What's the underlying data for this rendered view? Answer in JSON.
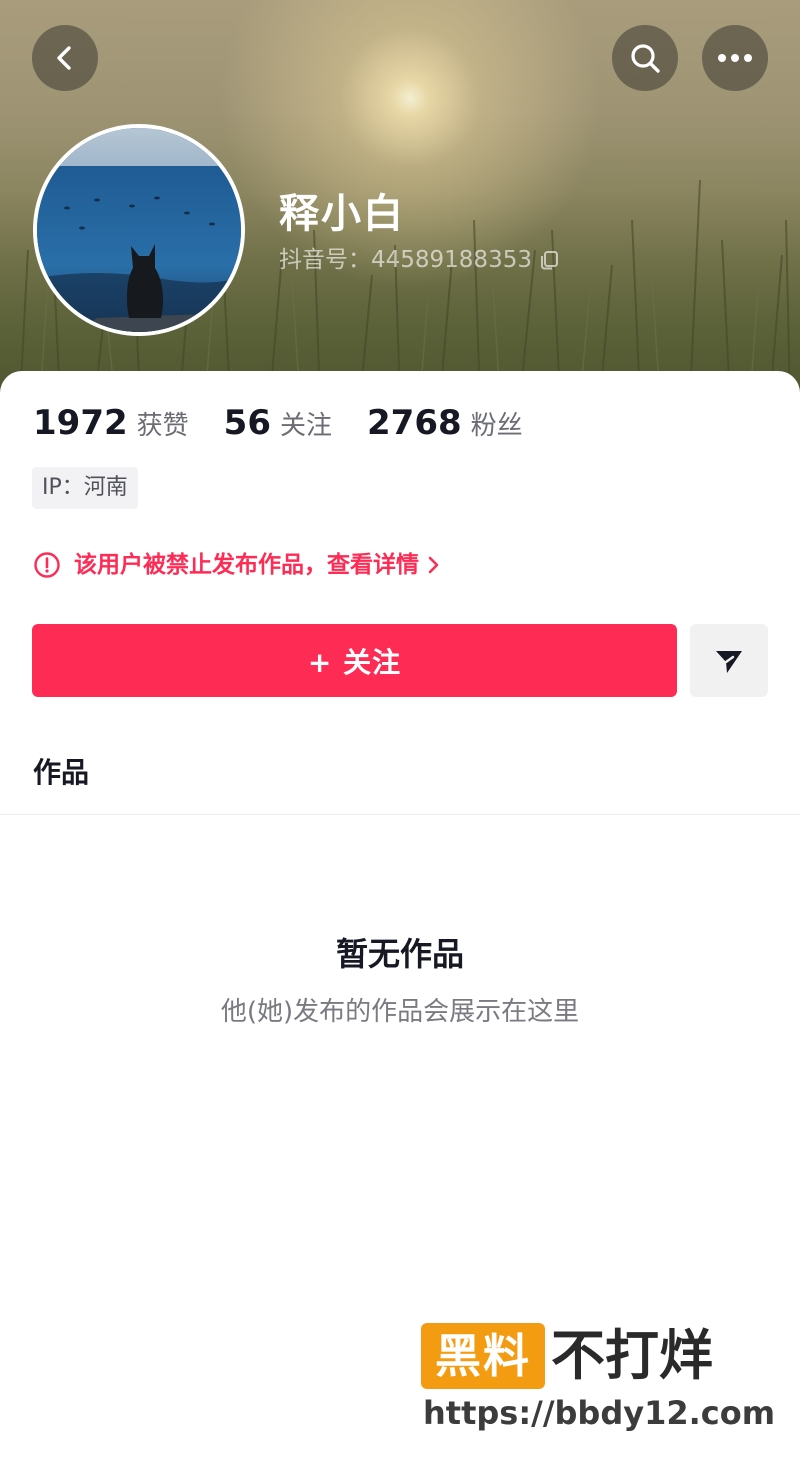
{
  "header": {
    "back_icon": "chevron-left-icon",
    "search_icon": "search-icon",
    "more_icon": "more-horizontal-icon"
  },
  "profile": {
    "nickname": "释小白",
    "douyin_id_text": "抖音号：44589188353",
    "copy_icon": "copy-icon"
  },
  "stats": [
    {
      "value": "1972",
      "label": "获赞"
    },
    {
      "value": "56",
      "label": "关注"
    },
    {
      "value": "2768",
      "label": "粉丝"
    }
  ],
  "ip_tag": "IP：河南",
  "notice": {
    "icon": "alert-circle-icon",
    "text": "该用户被禁止发布作品，查看详情",
    "color": "#fe2c55"
  },
  "actions": {
    "follow_label": "+ 关注",
    "message_icon": "send-icon",
    "accent": "#fe2c55"
  },
  "tabs": {
    "works_label": "作品"
  },
  "empty_state": {
    "title": "暂无作品",
    "subtitle": "他(她)发布的作品会展示在这里"
  },
  "watermark": {
    "badge": "黑料",
    "word": "不打烊",
    "url": "https://bbdy12.com"
  }
}
